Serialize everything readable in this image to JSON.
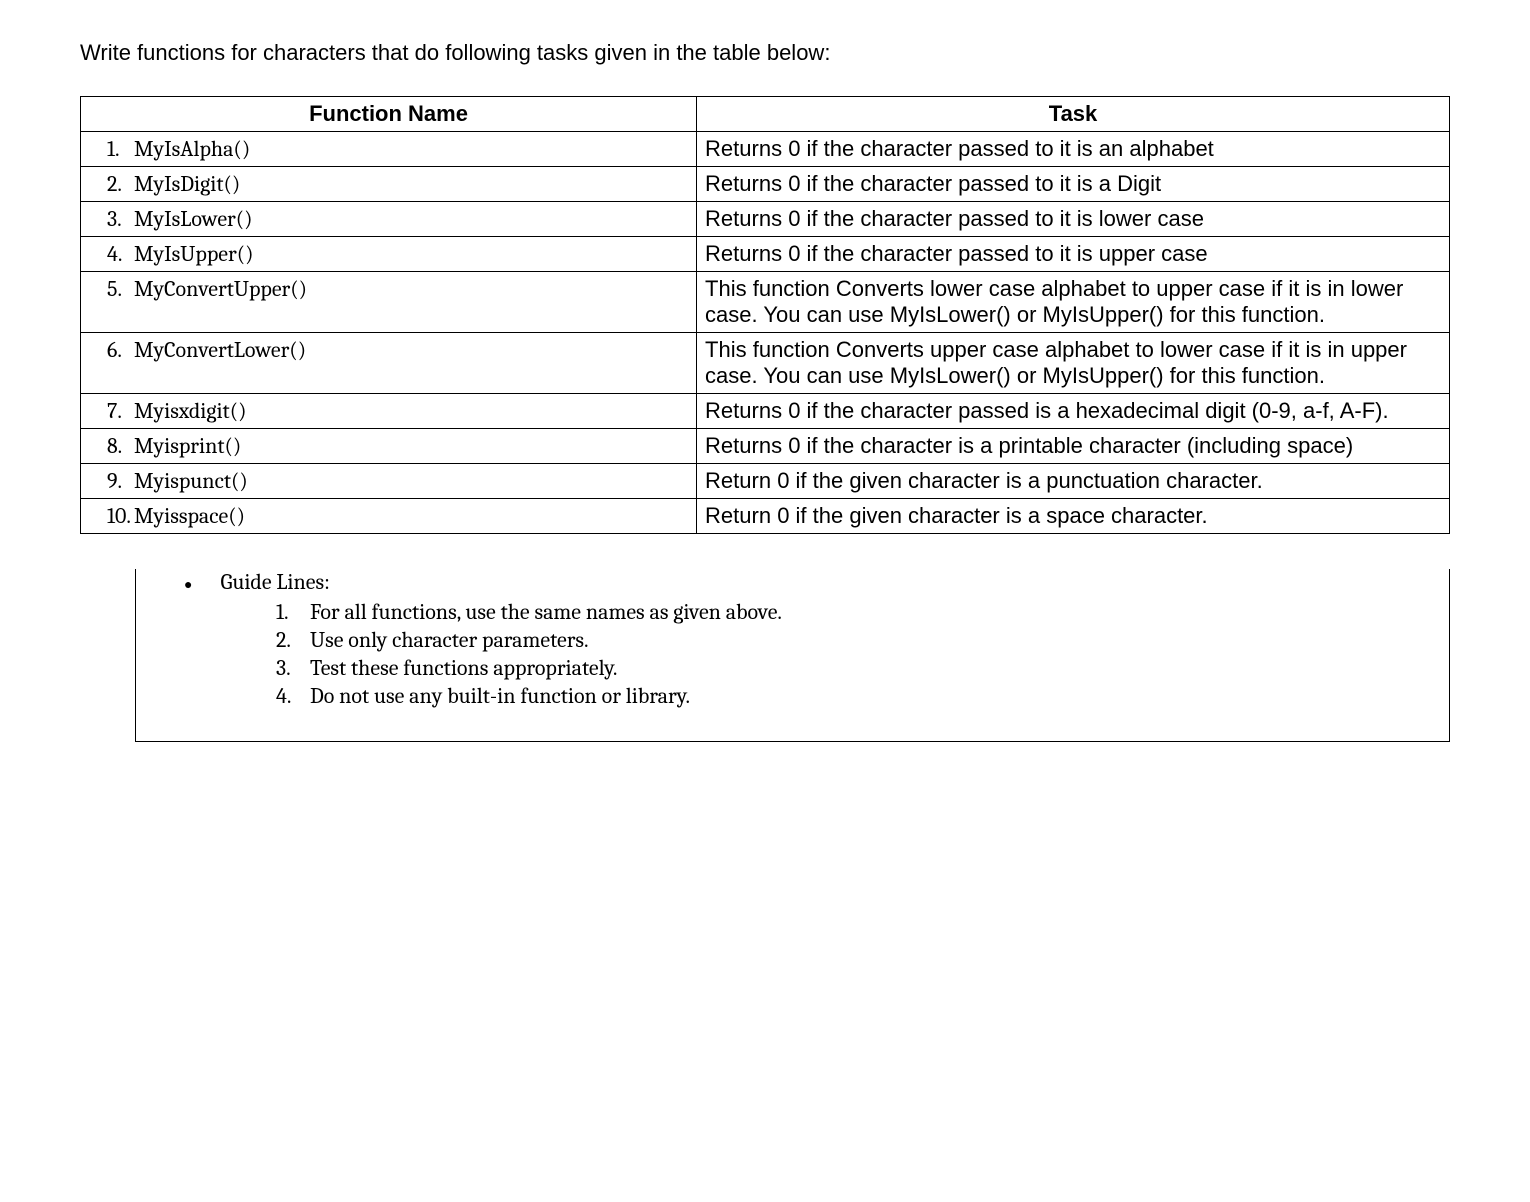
{
  "intro": "Write functions for characters that do following tasks given in the table below:",
  "headers": {
    "col1": "Function Name",
    "col2": "Task"
  },
  "rows": [
    {
      "num": "1.",
      "name": "MyIsAlpha()",
      "task": "Returns 0 if the character passed to it is an alphabet"
    },
    {
      "num": "2.",
      "name": "MyIsDigit()",
      "task": "Returns 0 if the character passed to it is a Digit"
    },
    {
      "num": "3.",
      "name": "MyIsLower()",
      "task": "Returns 0 if the character passed to it is lower case"
    },
    {
      "num": "4.",
      "name": "MyIsUpper()",
      "task": "Returns 0 if the character passed to it is upper case"
    },
    {
      "num": "5.",
      "name": "MyConvertUpper()",
      "task": "This function Converts lower case alphabet to upper case if it is in lower case. You can use MyIsLower() or MyIsUpper() for this function."
    },
    {
      "num": "6.",
      "name": "MyConvertLower()",
      "task": "This function Converts upper case alphabet to lower case if it is in upper case. You can use MyIsLower() or MyIsUpper() for this function."
    },
    {
      "num": "7.",
      "name": "Myisxdigit()",
      "task": "Returns 0 if the character passed is a hexadecimal digit (0-9, a-f, A-F)."
    },
    {
      "num": "8.",
      "name": "Myisprint()",
      "task": "Returns 0 if the character is a printable character (including space)"
    },
    {
      "num": "9.",
      "name": "Myispunct()",
      "task": "Return 0 if the given character is a punctuation character."
    },
    {
      "num": "10.",
      "name": "Myisspace()",
      "task": "Return 0 if the given character is a space character."
    }
  ],
  "guidelines": {
    "title": "Guide Lines:",
    "items": [
      {
        "num": "1.",
        "text": "For all functions, use the same names as given above."
      },
      {
        "num": "2.",
        "text": "Use only character parameters."
      },
      {
        "num": "3.",
        "text": "Test these functions appropriately."
      },
      {
        "num": "4.",
        "text": "Do not use any built-in function or library."
      }
    ]
  }
}
